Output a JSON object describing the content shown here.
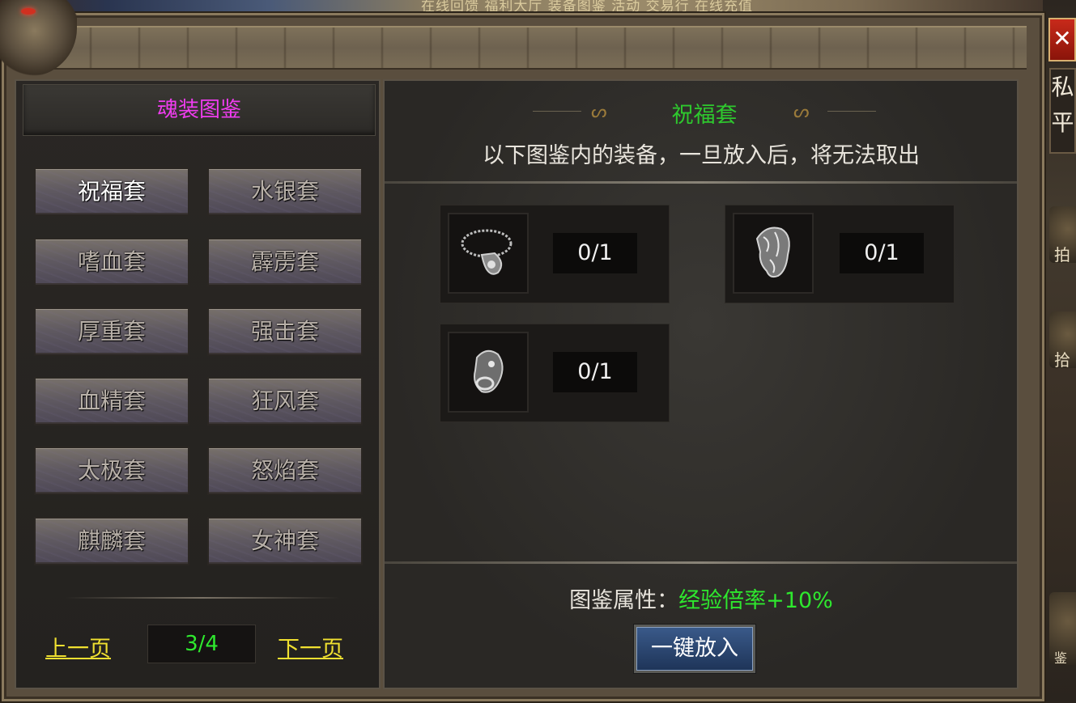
{
  "scene": {
    "top_text": "在线回馈  福利大厅  装备图鉴  活动  交易行  在线充值",
    "side_tab_label": "私\n平",
    "side_buttons": [
      "拍卖",
      "拾",
      "鉴"
    ]
  },
  "window": {
    "close_glyph": "✕"
  },
  "left": {
    "title": "魂装图鉴",
    "sets": [
      "祝福套",
      "水银套",
      "嗜血套",
      "霹雳套",
      "厚重套",
      "强击套",
      "血精套",
      "狂风套",
      "太极套",
      "怒焰套",
      "麒麟套",
      "女神套"
    ],
    "active_set": "祝福套",
    "pagination": {
      "prev_label": "上一页",
      "page": "3/4",
      "next_label": "下一页"
    }
  },
  "right": {
    "set_name": "祝福套",
    "notice": "以下图鉴内的装备，一旦放入后，将无法取出",
    "items": [
      {
        "icon": "necklace-icon",
        "count": "0/1"
      },
      {
        "icon": "helmet-icon",
        "count": "0/1"
      },
      {
        "icon": "bracelet-icon",
        "count": "0/1"
      }
    ],
    "attribute_label": "图鉴属性：",
    "attribute_value": "经验倍率+10%",
    "put_all_label": "一键放入"
  },
  "colors": {
    "title_magenta": "#f03cf0",
    "green_text": "#2ee82e",
    "link_yellow": "#f0e030",
    "close_red": "#c82a1a",
    "button_blue": "#2a4a78"
  }
}
